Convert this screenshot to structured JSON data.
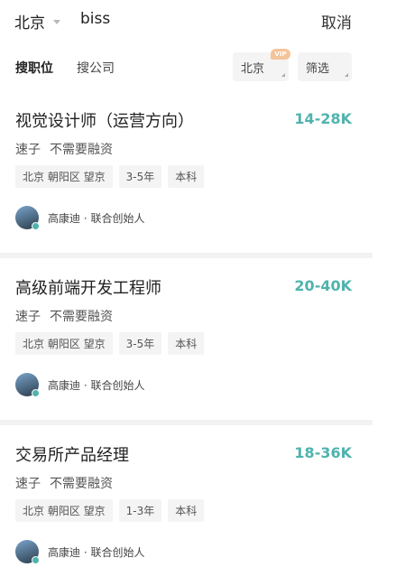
{
  "search": {
    "city": "北京",
    "query": "biss",
    "cancel_label": "取消"
  },
  "filters": {
    "tab_jobs": "搜职位",
    "tab_companies": "搜公司",
    "city_chip": "北京",
    "vip_badge": "VIP",
    "filter_chip": "筛选"
  },
  "jobs": [
    {
      "title": "视觉设计师（运营方向）",
      "salary": "14-28K",
      "company": "速子",
      "funding": "不需要融资",
      "tags": [
        "北京 朝阳区 望京",
        "3-5年",
        "本科"
      ],
      "recruiter": "高康迪 · 联合创始人"
    },
    {
      "title": "高级前端开发工程师",
      "salary": "20-40K",
      "company": "速子",
      "funding": "不需要融资",
      "tags": [
        "北京 朝阳区 望京",
        "3-5年",
        "本科"
      ],
      "recruiter": "高康迪 · 联合创始人"
    },
    {
      "title": "交易所产品经理",
      "salary": "18-36K",
      "company": "速子",
      "funding": "不需要融资",
      "tags": [
        "北京 朝阳区 望京",
        "1-3年",
        "本科"
      ],
      "recruiter": "高康迪 · 联合创始人"
    }
  ]
}
